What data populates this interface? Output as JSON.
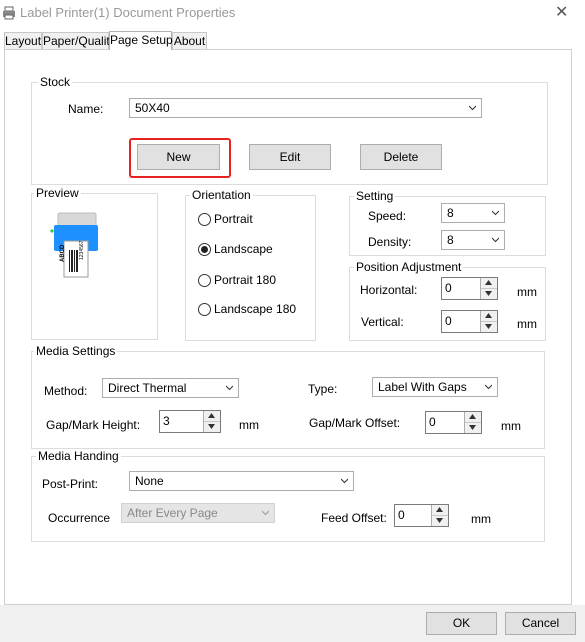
{
  "window": {
    "title": "Label Printer(1) Document Properties",
    "close_glyph": "✕"
  },
  "tabs": [
    {
      "label": "Layout"
    },
    {
      "label": "Paper/Quality"
    },
    {
      "label": "Page Setup"
    },
    {
      "label": "About"
    }
  ],
  "stock": {
    "group_label": "Stock",
    "name_label": "Name:",
    "name_value": "50X40",
    "new_label": "New",
    "edit_label": "Edit",
    "delete_label": "Delete"
  },
  "preview": {
    "group_label": "Preview",
    "label_text_1": "ABCD",
    "label_text_2": "1234567"
  },
  "orientation": {
    "group_label": "Orientation",
    "options": [
      {
        "label": "Portrait",
        "selected": false
      },
      {
        "label": "Landscape",
        "selected": true
      },
      {
        "label": "Portrait 180",
        "selected": false
      },
      {
        "label": "Landscape 180",
        "selected": false
      }
    ]
  },
  "setting": {
    "group_label": "Setting",
    "speed_label": "Speed:",
    "speed_value": "8",
    "density_label": "Density:",
    "density_value": "8"
  },
  "position": {
    "group_label": "Position Adjustment",
    "horizontal_label": "Horizontal:",
    "horizontal_value": "0",
    "horizontal_unit": "mm",
    "vertical_label": "Vertical:",
    "vertical_value": "0",
    "vertical_unit": "mm"
  },
  "media_settings": {
    "group_label": "Media Settings",
    "method_label": "Method:",
    "method_value": "Direct Thermal",
    "type_label": "Type:",
    "type_value": "Label With Gaps",
    "gap_height_label": "Gap/Mark Height:",
    "gap_height_value": "3",
    "gap_height_unit": "mm",
    "gap_offset_label": "Gap/Mark Offset:",
    "gap_offset_value": "0",
    "gap_offset_unit": "mm"
  },
  "media_handing": {
    "group_label": "Media Handing",
    "post_print_label": "Post-Print:",
    "post_print_value": "None",
    "occurrence_label": "Occurrence",
    "occurrence_value": "After Every Page",
    "feed_offset_label": "Feed Offset:",
    "feed_offset_value": "0",
    "feed_offset_unit": "mm"
  },
  "footer": {
    "ok_label": "OK",
    "cancel_label": "Cancel"
  },
  "colors": {
    "highlight": "#e8231f",
    "printer_blue": "#1e90ff"
  }
}
